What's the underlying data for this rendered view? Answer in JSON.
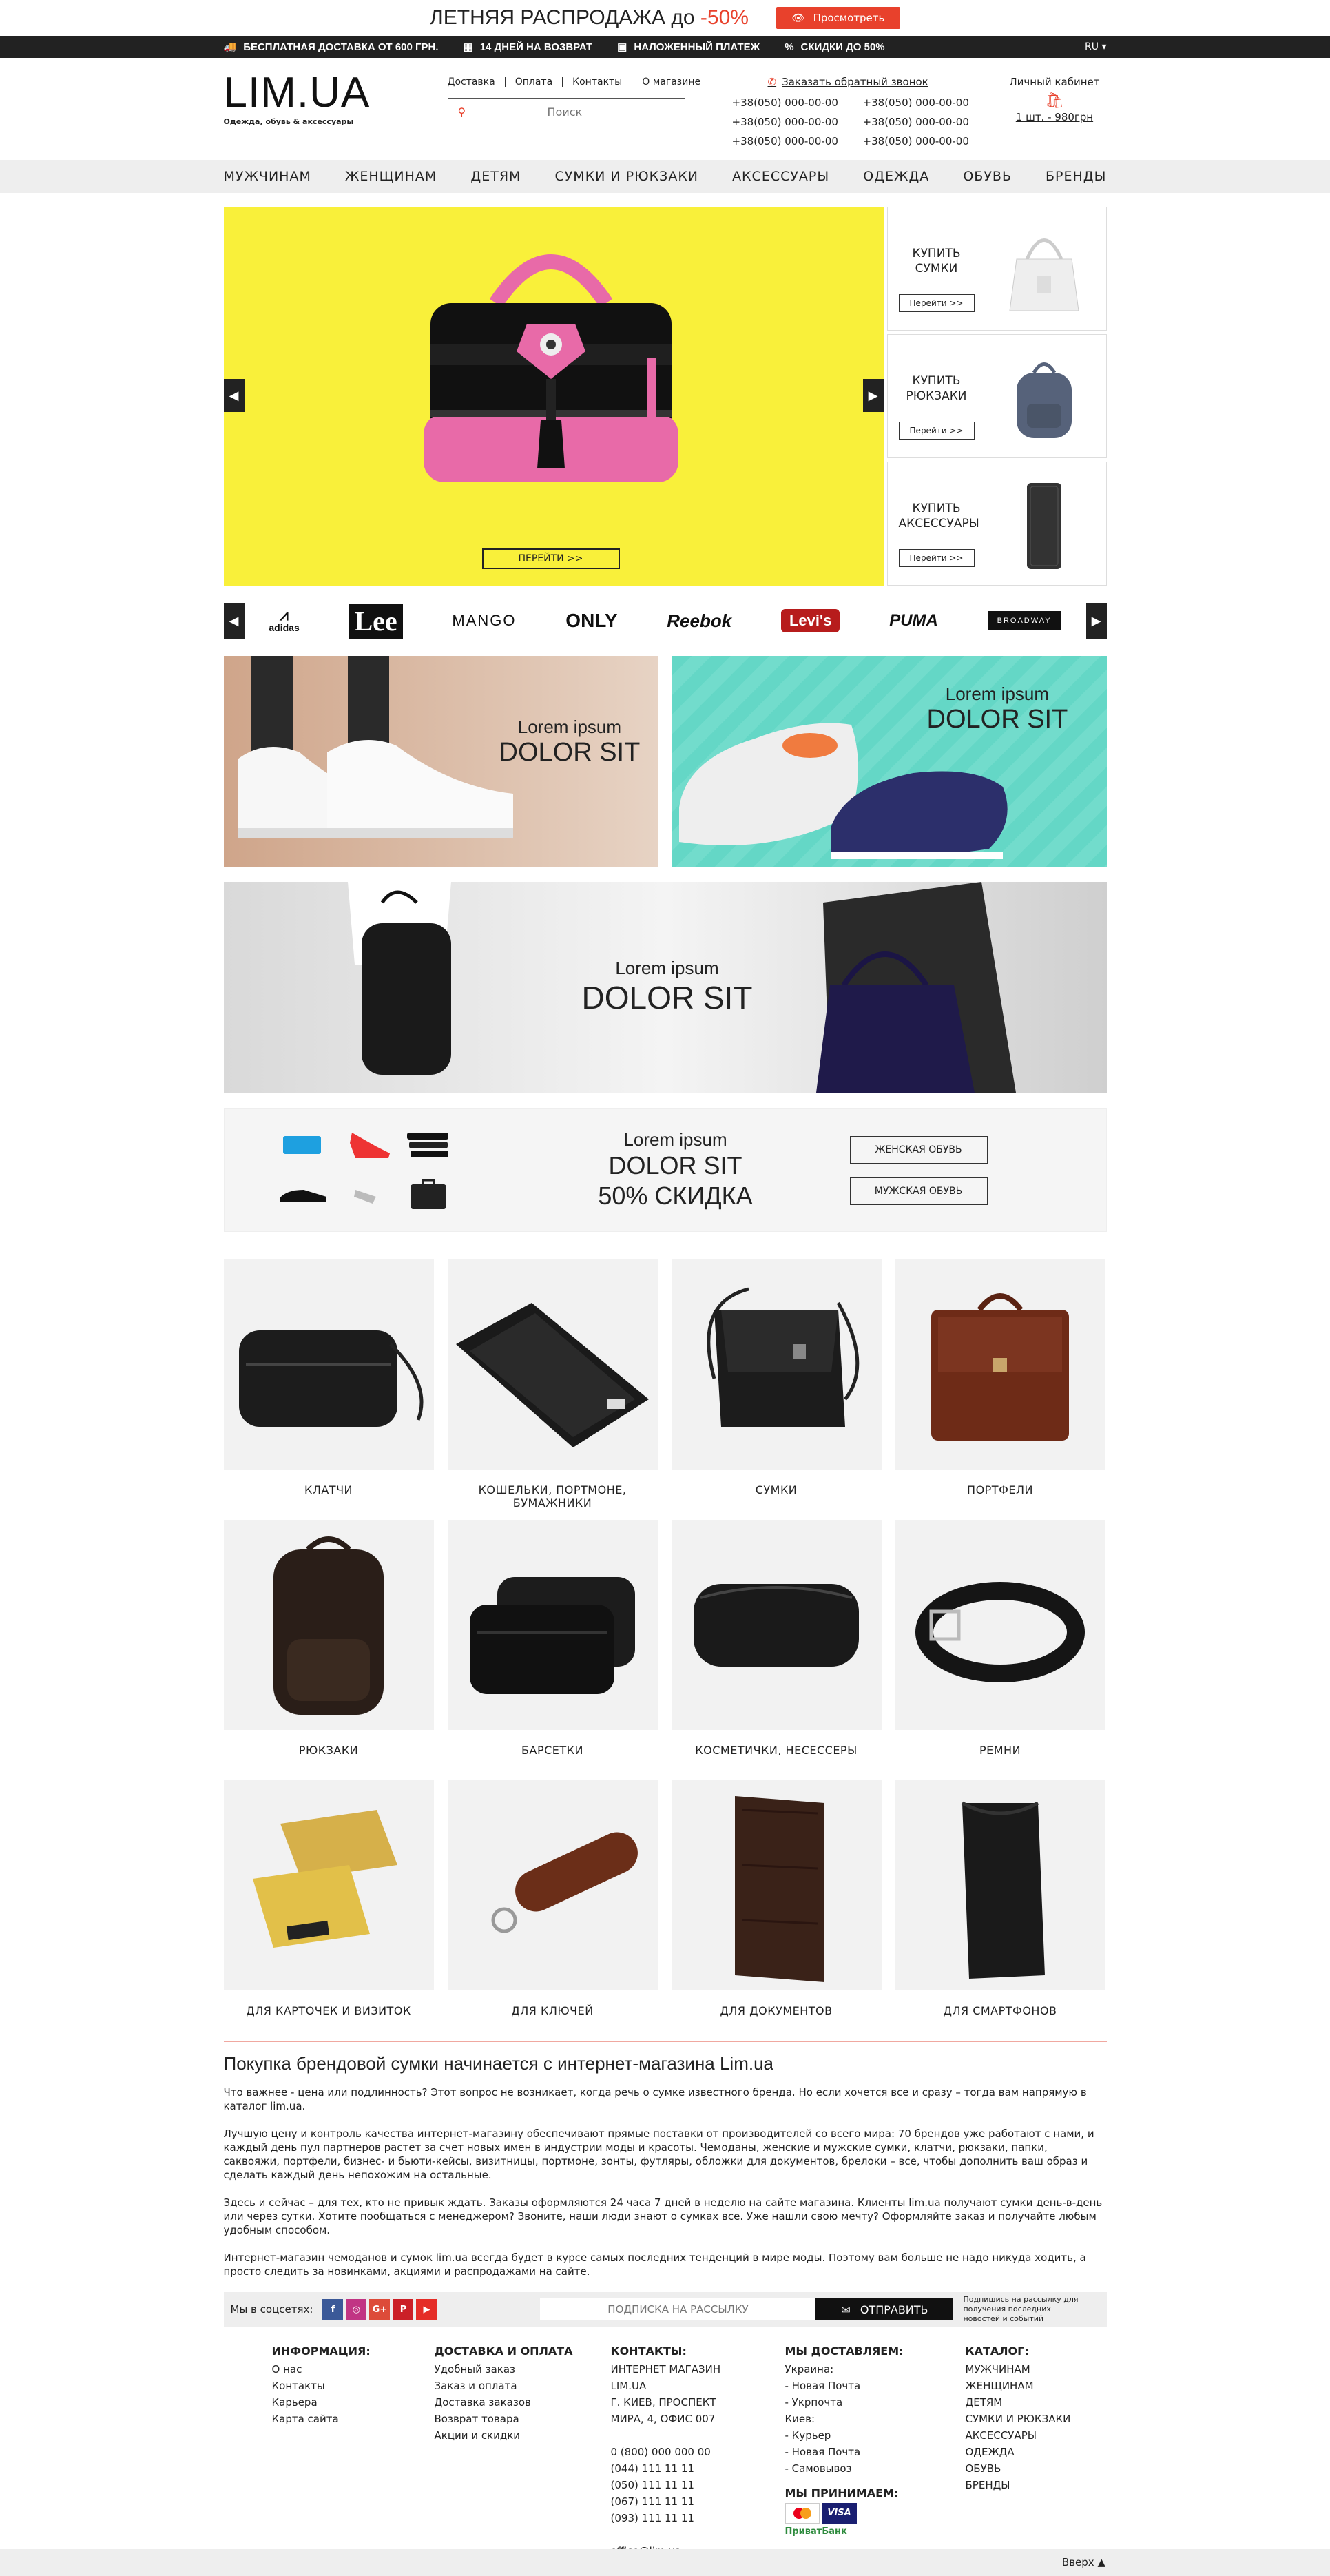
{
  "promo": {
    "text": "ЛЕТНЯЯ РАСПРОДАЖА до ",
    "discount": "-50%",
    "button": "Просмотреть"
  },
  "info_bar": {
    "items": [
      {
        "icon": "truck-icon",
        "text": "БЕСПЛАТНАЯ ДОСТАВКА ОТ 600 ГРН."
      },
      {
        "icon": "calendar-icon",
        "text": "14 ДНЕЙ НА ВОЗВРАТ"
      },
      {
        "icon": "box-icon",
        "text": "НАЛОЖЕННЫЙ ПЛАТЕЖ"
      },
      {
        "icon": "percent-icon",
        "text": "СКИДКИ ДО 50%"
      }
    ],
    "lang": "RU"
  },
  "header": {
    "logo": "LIM.UA",
    "tagline": "Одежда, обувь & аксессуары",
    "nav": [
      "Доставка",
      "Оплата",
      "Контакты",
      "О магазине"
    ],
    "search_placeholder": "Поиск",
    "callback": "Заказать обратный звонок",
    "phones": [
      "+38(050) 000-00-00",
      "+38(050) 000-00-00",
      "+38(050) 000-00-00",
      "+38(050) 000-00-00",
      "+38(050) 000-00-00",
      "+38(050) 000-00-00"
    ],
    "cabinet": "Личный кабинет",
    "cart": "1 шт. - 980грн"
  },
  "main_nav": [
    "МУЖЧИНАМ",
    "ЖЕНЩИНАМ",
    "ДЕТЯМ",
    "СУМКИ И РЮКЗАКИ",
    "АКСЕССУАРЫ",
    "ОДЕЖДА",
    "ОБУВЬ",
    "БРЕНДЫ"
  ],
  "hero": {
    "button": "ПЕРЕЙТИ >>",
    "side": [
      {
        "title": "КУПИТЬ СУМКИ",
        "button": "Перейти >>"
      },
      {
        "title": "КУПИТЬ РЮКЗАКИ",
        "button": "Перейти >>"
      },
      {
        "title": "КУПИТЬ АКСЕССУАРЫ",
        "button": "Перейти >>"
      }
    ]
  },
  "brands": [
    "adidas",
    "Lee",
    "MANGO",
    "ONLY",
    "Reebok",
    "Levi's",
    "PUMA",
    "BROADWAY"
  ],
  "banners": [
    {
      "line1": "Lorem ipsum",
      "line2": "DOLOR SIT"
    },
    {
      "line1": "Lorem ipsum",
      "line2": "DOLOR SIT"
    },
    {
      "line1": "Lorem ipsum",
      "line2": "DOLOR SIT"
    }
  ],
  "sale": {
    "line1": "Lorem ipsum",
    "line2": "DOLOR SIT",
    "line3": "50% СКИДКА",
    "btn1": "ЖЕНСКАЯ ОБУВЬ",
    "btn2": "МУЖСКАЯ ОБУВЬ"
  },
  "categories": [
    "КЛАТЧИ",
    "КОШЕЛЬКИ, ПОРТМОНЕ, БУМАЖНИКИ",
    "СУМКИ",
    "ПОРТФЕЛИ",
    "РЮКЗАКИ",
    "БАРСЕТКИ",
    "КОСМЕТИЧКИ, НЕСЕССЕРЫ",
    "РЕМНИ",
    "ДЛЯ КАРТОЧЕК И ВИЗИТОК",
    "ДЛЯ КЛЮЧЕЙ",
    "ДЛЯ ДОКУМЕНТОВ",
    "ДЛЯ СМАРТФОНОВ"
  ],
  "seo": {
    "title": "Покупка брендовой сумки начинается с интернет-магазина Lim.ua",
    "p1": "Что важнее - цена или подлинность? Этот вопрос не возникает, когда речь о сумке известного бренда. Но если хочется все и сразу – тогда вам напрямую в каталог lim.ua.",
    "p2": "Лучшую цену и контроль качества интернет-магазину обеспечивают прямые поставки от производителей со всего мира: 70 брендов уже работают с нами, и каждый день пул партнеров растет за счет новых имен в индустрии моды и красоты. Чемоданы, женские и мужские сумки, клатчи, рюкзаки, папки, саквояжи, портфели, бизнес- и бьюти-кейсы, визитницы, портмоне, зонты, футляры, обложки для документов, брелоки – все, чтобы дополнить ваш образ и сделать каждый день непохожим на остальные.",
    "p3": "Здесь и сейчас – для тех, кто не привык ждать. Заказы оформляются 24 часа 7 дней в неделю на сайте магазина. Клиенты lim.ua получают сумки день-в-день или через сутки. Хотите пообщаться с менеджером? Звоните, наши люди знают о сумках все. Уже нашли свою мечту? Оформляйте заказ и получайте любым удобным способом.",
    "p4": "Интернет-магазин чемоданов и сумок lim.ua всегда будет в курсе самых последних тенденций в мире моды. Поэтому вам больше не надо никуда ходить, а просто следить за новинками, акциями и распродажами на сайте."
  },
  "subscribe": {
    "social_label": "Мы в соцсетях:",
    "socials": [
      {
        "icon": "facebook-icon",
        "glyph": "f",
        "color": "#3b5998"
      },
      {
        "icon": "instagram-icon",
        "glyph": "◎",
        "color": "#c13584"
      },
      {
        "icon": "google-plus-icon",
        "glyph": "G+",
        "color": "#dd4b39"
      },
      {
        "icon": "pinterest-icon",
        "glyph": "P",
        "color": "#cb2027"
      },
      {
        "icon": "youtube-icon",
        "glyph": "▶",
        "color": "#e52d27"
      }
    ],
    "placeholder": "ПОДПИСКА НА РАССЫЛКУ",
    "button": "ОТПРАВИТЬ",
    "note": "Подпишись на рассылку для получения последних новостей и событий"
  },
  "footer": {
    "info": {
      "title": "ИНФОРМАЦИЯ:",
      "links": [
        "О нас",
        "Контакты",
        "Карьера",
        "Карта сайта"
      ]
    },
    "delivery": {
      "title": "ДОСТАВКА И ОПЛАТА",
      "links": [
        "Удобный заказ",
        "Заказ и оплата",
        "Доставка заказов",
        "Возврат товара",
        "Акции и скидки"
      ]
    },
    "contacts": {
      "title": "КОНТАКТЫ:",
      "lines": [
        "ИНТЕРНЕТ МАГАЗИН",
        "LIM.UA",
        "Г. КИЕВ, ПРОСПЕКТ",
        "МИРА, 4, ОФИС 007",
        "",
        "0 (800) 000 000 00",
        "(044) 111 11 11",
        "(050) 111 11 11",
        "(067) 111 11 11",
        "(093) 111 11 11",
        "",
        "office@lim.ua"
      ]
    },
    "ship": {
      "title": "МЫ ДОСТАВЛЯЕМ:",
      "lines": [
        "Украина:",
        "- Новая Почта",
        "- Укрпочта",
        "Киев:",
        "- Курьер",
        "- Новая Почта",
        "- Самовывоз"
      ],
      "accept": "МЫ ПРИНИМАЕМ:",
      "visa": "VISA",
      "privat": "ПриватБанк"
    },
    "catalog": {
      "title": "КАТАЛОГ:",
      "links": [
        "МУЖЧИНАМ",
        "ЖЕНЩИНАМ",
        "ДЕТЯМ",
        "СУМКИ И РЮКЗАКИ",
        "АКСЕССУАРЫ",
        "ОДЕЖДА",
        "ОБУВЬ",
        "БРЕНДЫ"
      ]
    }
  },
  "bottom": {
    "up": "Вверх"
  }
}
